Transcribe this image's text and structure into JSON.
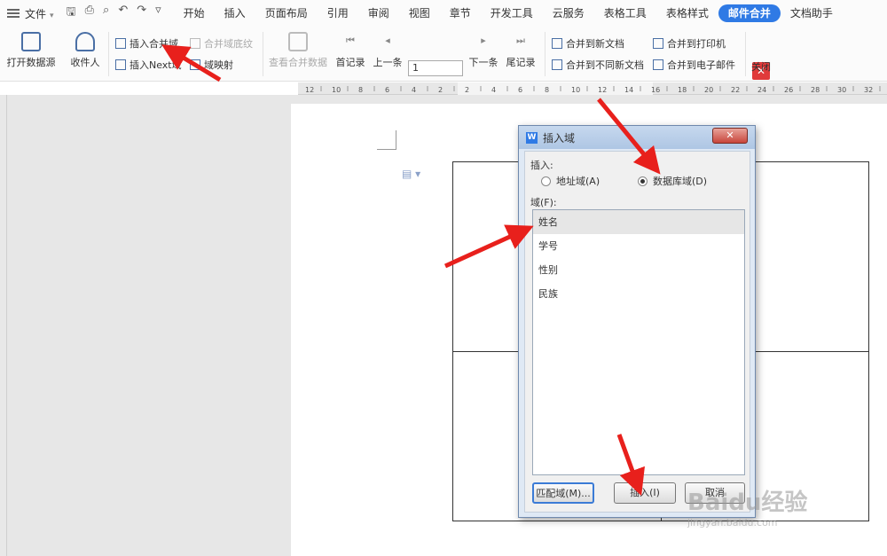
{
  "menubar": {
    "file_label": "文件",
    "tabs": [
      "开始",
      "插入",
      "页面布局",
      "引用",
      "审阅",
      "视图",
      "章节",
      "开发工具",
      "云服务",
      "表格工具",
      "表格样式",
      "邮件合并",
      "文档助手"
    ]
  },
  "ribbon": {
    "open_source": "打开数据源",
    "recipients": "收件人",
    "insert_merge_field": "插入合并域",
    "merge_field_shading": "合并域底纹",
    "insert_next": "插入Next域",
    "field_mapping": "域映射",
    "view_merged_data": "查看合并数据",
    "first_record": "首记录",
    "prev_record": "上一条",
    "record_number": "1",
    "next_record": "下一条",
    "last_record": "尾记录",
    "merge_new_doc": "合并到新文档",
    "merge_diff_docs": "合并到不同新文档",
    "merge_printer": "合并到打印机",
    "merge_email": "合并到电子邮件",
    "close": "关闭"
  },
  "ruler_marks": [
    "12",
    "10",
    "8",
    "6",
    "4",
    "2",
    "2",
    "4",
    "6",
    "8",
    "10",
    "12",
    "14",
    "16",
    "18",
    "20",
    "22",
    "24",
    "26",
    "28",
    "30",
    "32"
  ],
  "dialog": {
    "title": "插入域",
    "insert_label": "插入:",
    "radio_address": "地址域(A)",
    "radio_database": "数据库域(D)",
    "selected_radio": "数据库域(D)",
    "field_label": "域(F):",
    "fields": [
      "姓名",
      "学号",
      "性别",
      "民族"
    ],
    "selected_field": "姓名",
    "match_button": "匹配域(M)...",
    "insert_button": "插入(I)",
    "cancel_button": "取消"
  },
  "watermark": {
    "brand": "Baidu经验",
    "url": "jingyan.baidu.com"
  },
  "colors": {
    "accent": "#2f7ae5",
    "arrow": "#e8201c",
    "close": "#e03a3a"
  }
}
